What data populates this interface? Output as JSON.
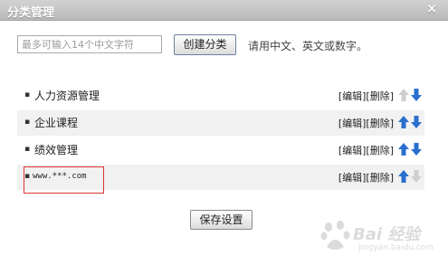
{
  "dialog": {
    "title": "分类管理",
    "close_glyph": "×"
  },
  "form": {
    "input_placeholder": "最多可输入14个中文字符",
    "create_label": "创建分类",
    "hint": "请用中文、英文或数字。"
  },
  "categories": [
    {
      "name": "人力资源管理",
      "edit_label": "[编辑]",
      "delete_label": "[删除]",
      "up_enabled": false,
      "down_enabled": true
    },
    {
      "name": "企业课程",
      "edit_label": "[编辑]",
      "delete_label": "[删除]",
      "up_enabled": true,
      "down_enabled": true
    },
    {
      "name": "绩效管理",
      "edit_label": "[编辑]",
      "delete_label": "[删除]",
      "up_enabled": true,
      "down_enabled": true
    },
    {
      "name": "www.***.com",
      "edit_label": "[编辑]",
      "delete_label": "[删除]",
      "up_enabled": true,
      "down_enabled": false
    }
  ],
  "footer": {
    "save_label": "保存设置"
  },
  "watermark": {
    "brand": "Bai 经验",
    "url": "jingyan.baidu.com"
  },
  "colors": {
    "arrow_active": "#2a6fce",
    "arrow_disabled": "#cfcfcf",
    "highlight_border": "#d9352f",
    "titlebar": "#bfbfbf"
  }
}
